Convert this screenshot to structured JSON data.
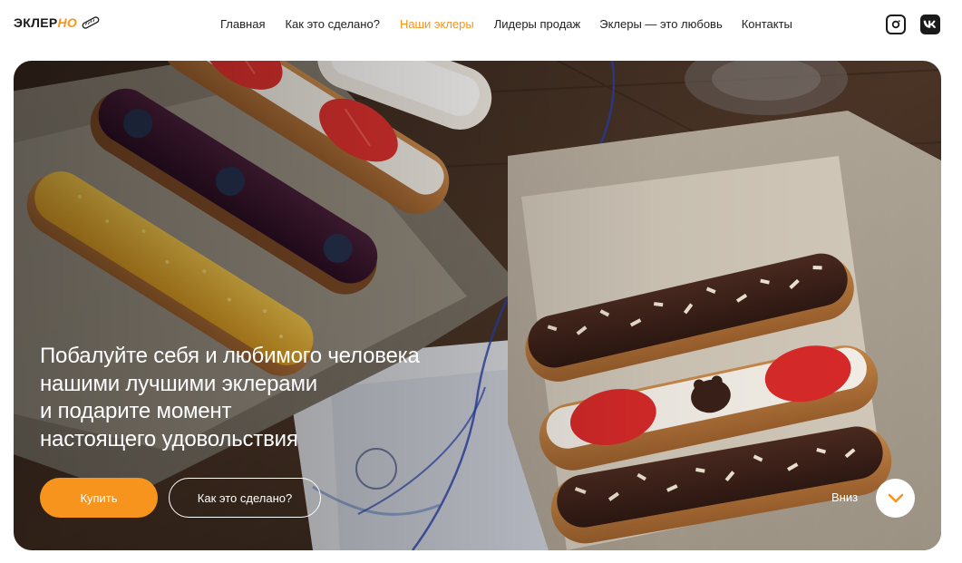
{
  "brand": {
    "name_main": "ЭКЛЕР",
    "name_accent": "НО",
    "icon": "eclair-icon",
    "accent_color": "#f7941d"
  },
  "nav": {
    "items": [
      {
        "label": "Главная",
        "active": false
      },
      {
        "label": "Как это сделано?",
        "active": false
      },
      {
        "label": "Наши эклеры",
        "active": true
      },
      {
        "label": "Лидеры продаж",
        "active": false
      },
      {
        "label": "Эклеры — это любовь",
        "active": false
      },
      {
        "label": "Контакты",
        "active": false
      }
    ]
  },
  "social": {
    "instagram_icon": "instagram-icon",
    "vk_icon": "vk-icon"
  },
  "hero": {
    "title_lines": [
      "Побалуйте себя и любимого человека",
      "нашими лучшими эклерами",
      "и подарите момент",
      "настоящего удовольствия"
    ],
    "buy_label": "Купить",
    "how_label": "Как это сделано?",
    "down_label": "Вниз",
    "down_icon": "chevron-down-icon"
  }
}
